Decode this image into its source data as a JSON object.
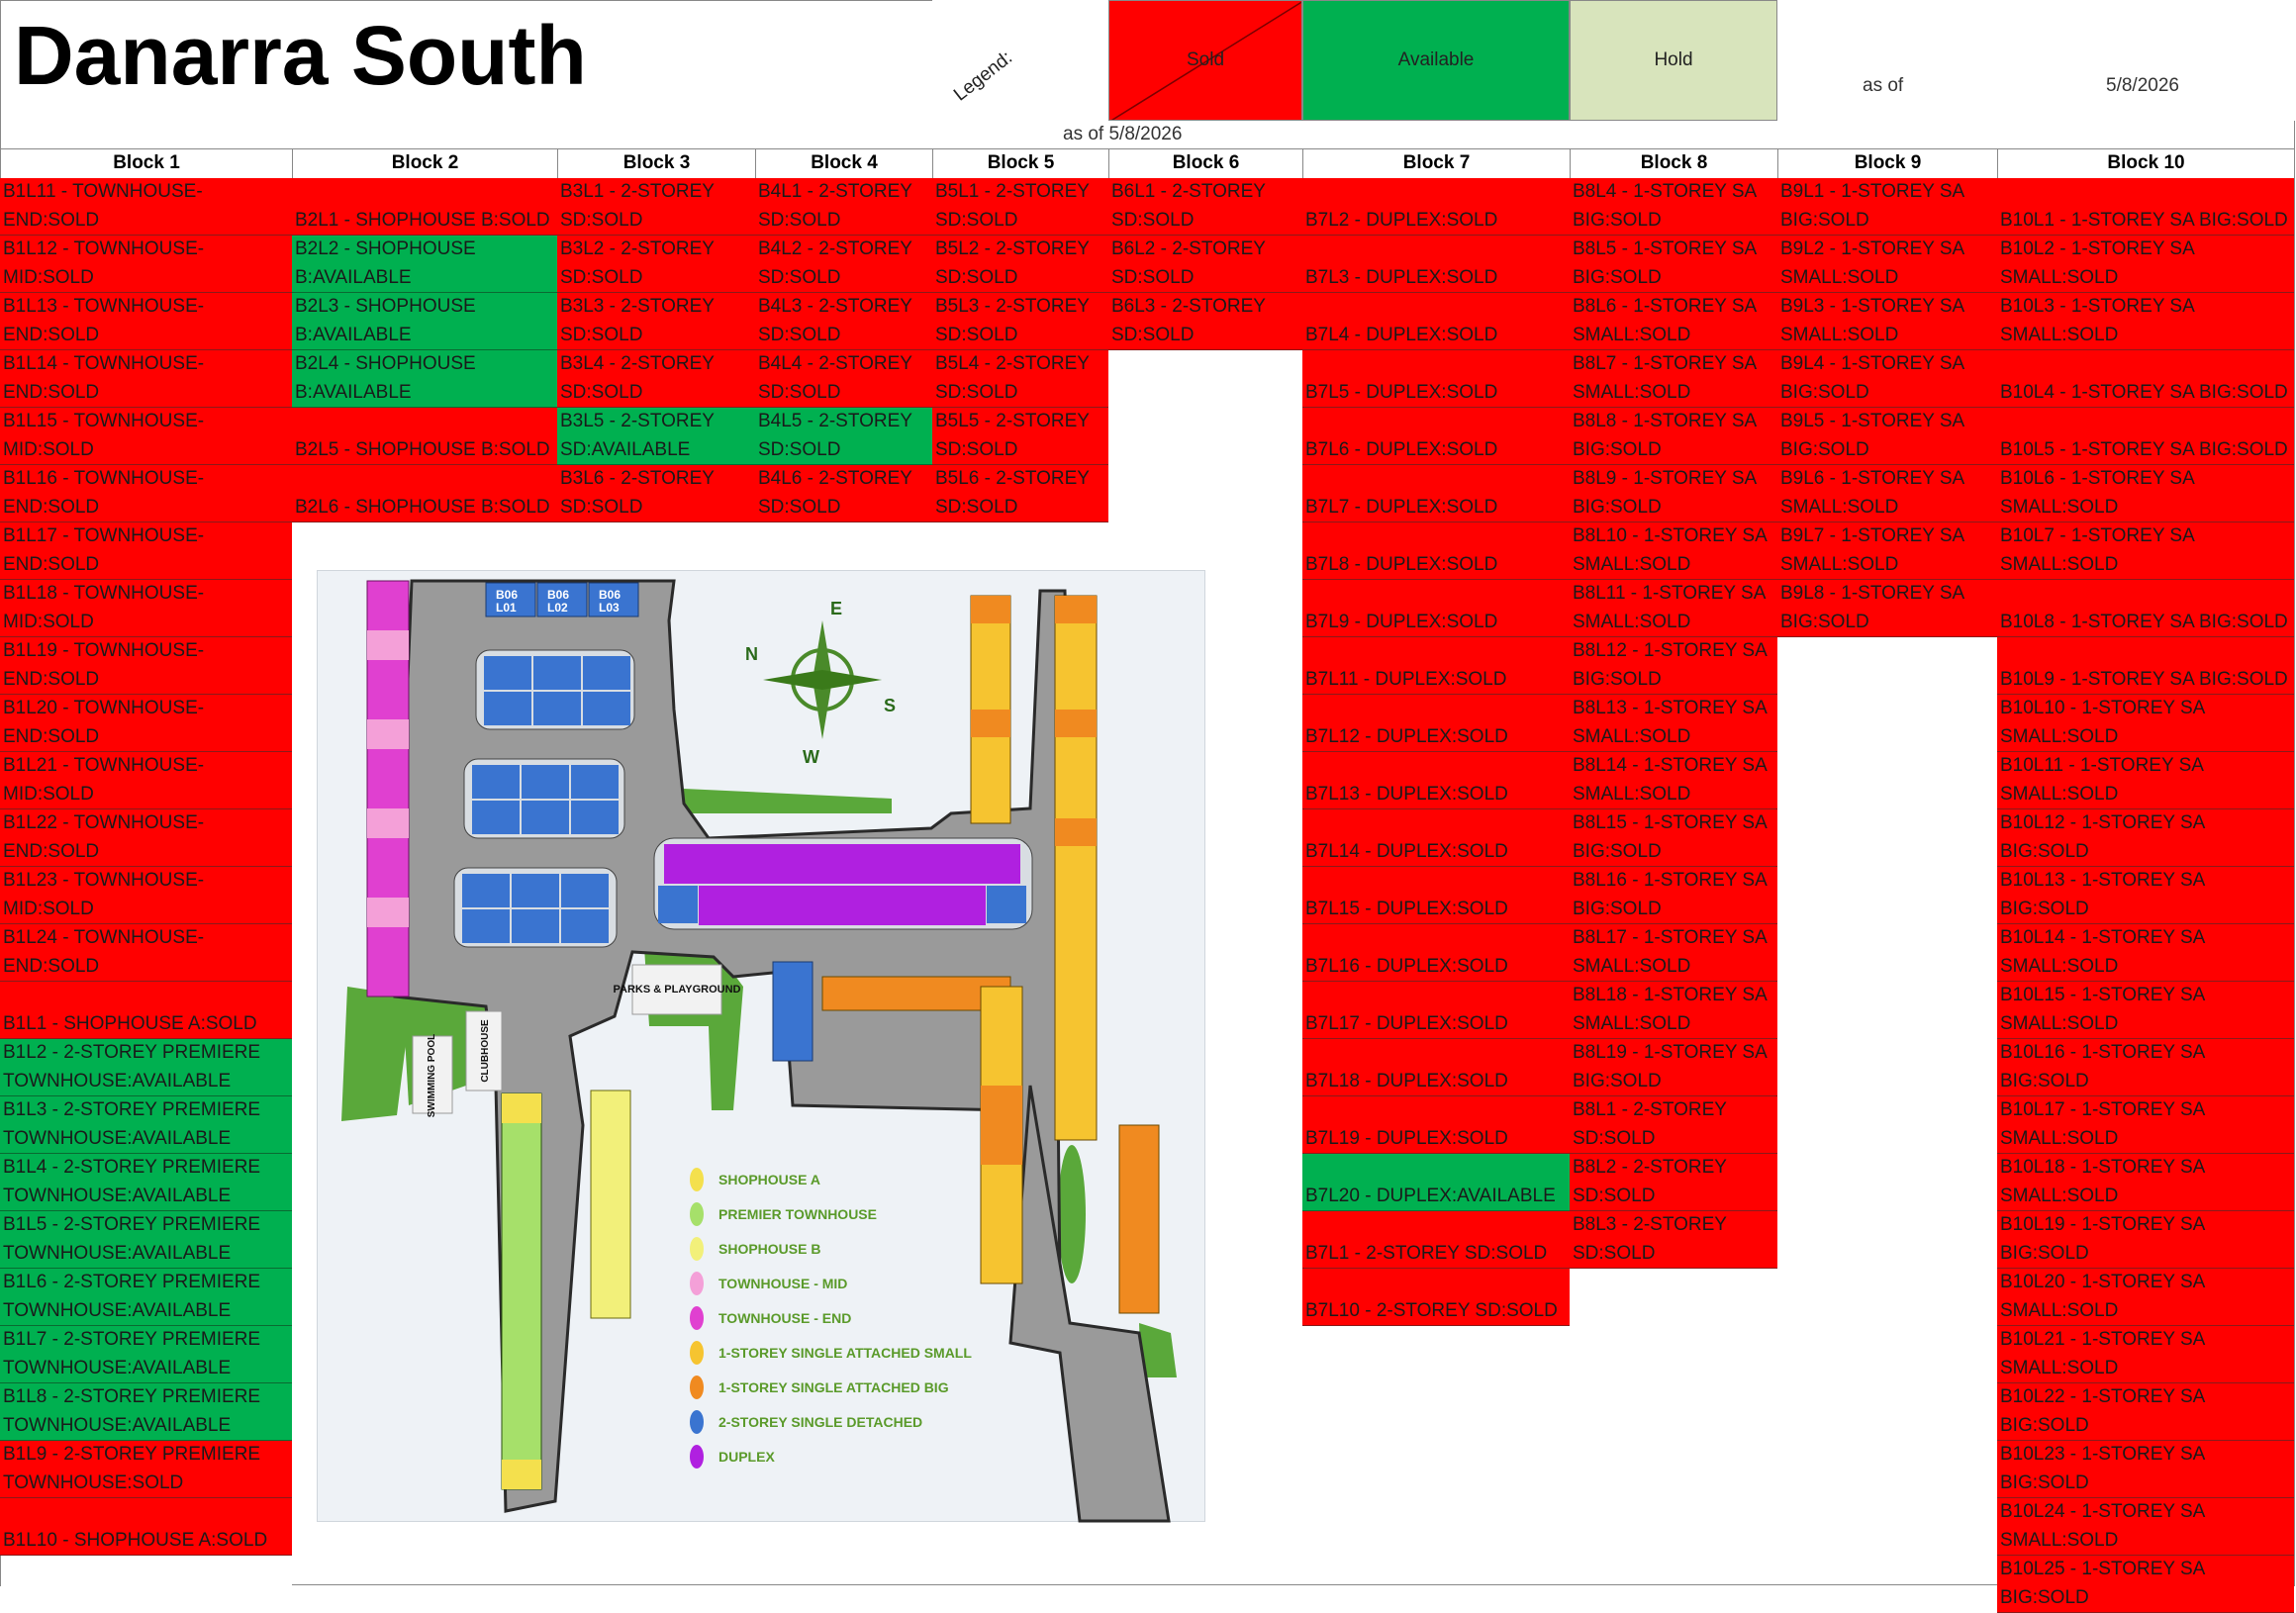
{
  "title": "Danarra South",
  "legend": {
    "label": "Legend:",
    "sold": "Sold",
    "available": "Available",
    "hold": "Hold",
    "colors": {
      "sold": "#ff0000",
      "available": "#00b050",
      "hold": "#d8e4bc"
    }
  },
  "as_of_label": "as of",
  "as_of_date": "5/8/2026",
  "as_of_combined": "as of  5/8/2026",
  "columns": [
    {
      "header": "Block 1",
      "cells": [
        {
          "text": "B1L11 - TOWNHOUSE-END:SOLD",
          "status": "sold"
        },
        {
          "text": "B1L12 - TOWNHOUSE-MID:SOLD",
          "status": "sold"
        },
        {
          "text": "B1L13 - TOWNHOUSE-END:SOLD",
          "status": "sold"
        },
        {
          "text": "B1L14 - TOWNHOUSE-END:SOLD",
          "status": "sold"
        },
        {
          "text": "B1L15 - TOWNHOUSE-MID:SOLD",
          "status": "sold"
        },
        {
          "text": "B1L16 - TOWNHOUSE-END:SOLD",
          "status": "sold"
        },
        {
          "text": "B1L17 - TOWNHOUSE-END:SOLD",
          "status": "sold"
        },
        {
          "text": "B1L18 - TOWNHOUSE-MID:SOLD",
          "status": "sold"
        },
        {
          "text": "B1L19 - TOWNHOUSE-END:SOLD",
          "status": "sold"
        },
        {
          "text": "B1L20 - TOWNHOUSE-END:SOLD",
          "status": "sold"
        },
        {
          "text": "B1L21 - TOWNHOUSE-MID:SOLD",
          "status": "sold"
        },
        {
          "text": "B1L22 - TOWNHOUSE-END:SOLD",
          "status": "sold"
        },
        {
          "text": "B1L23 - TOWNHOUSE-MID:SOLD",
          "status": "sold"
        },
        {
          "text": "B1L24 - TOWNHOUSE-END:SOLD",
          "status": "sold"
        },
        {
          "text": "B1L1 - SHOPHOUSE A:SOLD",
          "status": "sold"
        },
        {
          "text": "B1L2 - 2-STOREY PREMIERE TOWNHOUSE:AVAILABLE",
          "status": "avail"
        },
        {
          "text": "B1L3 - 2-STOREY PREMIERE TOWNHOUSE:AVAILABLE",
          "status": "avail"
        },
        {
          "text": "B1L4 - 2-STOREY PREMIERE TOWNHOUSE:AVAILABLE",
          "status": "avail"
        },
        {
          "text": "B1L5 - 2-STOREY PREMIERE TOWNHOUSE:AVAILABLE",
          "status": "avail"
        },
        {
          "text": "B1L6 - 2-STOREY PREMIERE TOWNHOUSE:AVAILABLE",
          "status": "avail"
        },
        {
          "text": "B1L7 - 2-STOREY PREMIERE TOWNHOUSE:AVAILABLE",
          "status": "avail"
        },
        {
          "text": "B1L8 - 2-STOREY PREMIERE TOWNHOUSE:AVAILABLE",
          "status": "avail"
        },
        {
          "text": "B1L9 - 2-STOREY PREMIERE TOWNHOUSE:SOLD",
          "status": "sold"
        },
        {
          "text": "B1L10 - SHOPHOUSE A:SOLD",
          "status": "sold"
        }
      ]
    },
    {
      "header": "Block 2",
      "cells": [
        {
          "text": "B2L1 - SHOPHOUSE B:SOLD",
          "status": "sold"
        },
        {
          "text": "B2L2 - SHOPHOUSE B:AVAILABLE",
          "status": "avail"
        },
        {
          "text": "B2L3 - SHOPHOUSE B:AVAILABLE",
          "status": "avail"
        },
        {
          "text": "B2L4 - SHOPHOUSE B:AVAILABLE",
          "status": "avail"
        },
        {
          "text": "B2L5 - SHOPHOUSE B:SOLD",
          "status": "sold"
        },
        {
          "text": "B2L6 - SHOPHOUSE B:SOLD",
          "status": "sold"
        }
      ]
    },
    {
      "header": "Block 3",
      "cells": [
        {
          "text": "B3L1 - 2-STOREY SD:SOLD",
          "status": "sold"
        },
        {
          "text": "B3L2 - 2-STOREY SD:SOLD",
          "status": "sold"
        },
        {
          "text": "B3L3 - 2-STOREY SD:SOLD",
          "status": "sold"
        },
        {
          "text": "B3L4 - 2-STOREY SD:SOLD",
          "status": "sold"
        },
        {
          "text": "B3L5 - 2-STOREY SD:AVAILABLE",
          "status": "avail"
        },
        {
          "text": "B3L6 - 2-STOREY SD:SOLD",
          "status": "sold"
        }
      ]
    },
    {
      "header": "Block 4",
      "cells": [
        {
          "text": "B4L1 - 2-STOREY SD:SOLD",
          "status": "sold"
        },
        {
          "text": "B4L2 - 2-STOREY SD:SOLD",
          "status": "sold"
        },
        {
          "text": "B4L3 - 2-STOREY SD:SOLD",
          "status": "sold"
        },
        {
          "text": "B4L4 - 2-STOREY SD:SOLD",
          "status": "sold"
        },
        {
          "text": "B4L5 - 2-STOREY SD:SOLD",
          "status": "avail"
        },
        {
          "text": "B4L6 - 2-STOREY SD:SOLD",
          "status": "sold"
        }
      ]
    },
    {
      "header": "Block 5",
      "cells": [
        {
          "text": "B5L1 - 2-STOREY SD:SOLD",
          "status": "sold"
        },
        {
          "text": "B5L2 - 2-STOREY SD:SOLD",
          "status": "sold"
        },
        {
          "text": "B5L3 - 2-STOREY SD:SOLD",
          "status": "sold"
        },
        {
          "text": "B5L4 - 2-STOREY SD:SOLD",
          "status": "sold"
        },
        {
          "text": "B5L5 - 2-STOREY SD:SOLD",
          "status": "sold"
        },
        {
          "text": "B5L6 - 2-STOREY SD:SOLD",
          "status": "sold"
        }
      ]
    },
    {
      "header": "Block 6",
      "cells": [
        {
          "text": "B6L1 - 2-STOREY SD:SOLD",
          "status": "sold"
        },
        {
          "text": "B6L2 - 2-STOREY SD:SOLD",
          "status": "sold"
        },
        {
          "text": "B6L3 - 2-STOREY SD:SOLD",
          "status": "sold"
        }
      ]
    },
    {
      "header": "Block 7",
      "cells": [
        {
          "text": "B7L2 - DUPLEX:SOLD",
          "status": "sold"
        },
        {
          "text": "B7L3 - DUPLEX:SOLD",
          "status": "sold"
        },
        {
          "text": "B7L4 - DUPLEX:SOLD",
          "status": "sold"
        },
        {
          "text": "B7L5 - DUPLEX:SOLD",
          "status": "sold"
        },
        {
          "text": "B7L6 - DUPLEX:SOLD",
          "status": "sold"
        },
        {
          "text": "B7L7 - DUPLEX:SOLD",
          "status": "sold"
        },
        {
          "text": "B7L8 - DUPLEX:SOLD",
          "status": "sold"
        },
        {
          "text": "B7L9 - DUPLEX:SOLD",
          "status": "sold"
        },
        {
          "text": "B7L11 - DUPLEX:SOLD",
          "status": "sold"
        },
        {
          "text": "B7L12 - DUPLEX:SOLD",
          "status": "sold"
        },
        {
          "text": "B7L13 - DUPLEX:SOLD",
          "status": "sold"
        },
        {
          "text": "B7L14 - DUPLEX:SOLD",
          "status": "sold"
        },
        {
          "text": "B7L15 - DUPLEX:SOLD",
          "status": "sold"
        },
        {
          "text": "B7L16 - DUPLEX:SOLD",
          "status": "sold"
        },
        {
          "text": "B7L17 - DUPLEX:SOLD",
          "status": "sold"
        },
        {
          "text": "B7L18 - DUPLEX:SOLD",
          "status": "sold"
        },
        {
          "text": "B7L19 - DUPLEX:SOLD",
          "status": "sold"
        },
        {
          "text": "B7L20 - DUPLEX:AVAILABLE",
          "status": "avail"
        },
        {
          "text": "B7L1 - 2-STOREY SD:SOLD",
          "status": "sold"
        },
        {
          "text": "B7L10 - 2-STOREY SD:SOLD",
          "status": "sold"
        }
      ]
    },
    {
      "header": "Block 8",
      "cells": [
        {
          "text": "B8L4 - 1-STOREY SA BIG:SOLD",
          "status": "sold"
        },
        {
          "text": "B8L5 - 1-STOREY SA BIG:SOLD",
          "status": "sold"
        },
        {
          "text": "B8L6 - 1-STOREY SA SMALL:SOLD",
          "status": "sold"
        },
        {
          "text": "B8L7 - 1-STOREY SA SMALL:SOLD",
          "status": "sold"
        },
        {
          "text": "B8L8 - 1-STOREY SA BIG:SOLD",
          "status": "sold"
        },
        {
          "text": "B8L9 - 1-STOREY SA BIG:SOLD",
          "status": "sold"
        },
        {
          "text": "B8L10 - 1-STOREY SA SMALL:SOLD",
          "status": "sold"
        },
        {
          "text": "B8L11 - 1-STOREY SA SMALL:SOLD",
          "status": "sold"
        },
        {
          "text": "B8L12 - 1-STOREY SA BIG:SOLD",
          "status": "sold"
        },
        {
          "text": "B8L13 - 1-STOREY SA SMALL:SOLD",
          "status": "sold"
        },
        {
          "text": "B8L14 - 1-STOREY SA SMALL:SOLD",
          "status": "sold"
        },
        {
          "text": "B8L15 - 1-STOREY SA BIG:SOLD",
          "status": "sold"
        },
        {
          "text": "B8L16 - 1-STOREY SA BIG:SOLD",
          "status": "sold"
        },
        {
          "text": "B8L17 - 1-STOREY SA SMALL:SOLD",
          "status": "sold"
        },
        {
          "text": "B8L18 - 1-STOREY SA SMALL:SOLD",
          "status": "sold"
        },
        {
          "text": "B8L19 - 1-STOREY SA BIG:SOLD",
          "status": "sold"
        },
        {
          "text": "B8L1 - 2-STOREY SD:SOLD",
          "status": "sold"
        },
        {
          "text": "B8L2 - 2-STOREY SD:SOLD",
          "status": "sold"
        },
        {
          "text": "B8L3 - 2-STOREY SD:SOLD",
          "status": "sold"
        }
      ]
    },
    {
      "header": "Block 9",
      "cells": [
        {
          "text": "B9L1 - 1-STOREY SA BIG:SOLD",
          "status": "sold"
        },
        {
          "text": "B9L2 - 1-STOREY SA SMALL:SOLD",
          "status": "sold"
        },
        {
          "text": "B9L3 - 1-STOREY SA SMALL:SOLD",
          "status": "sold"
        },
        {
          "text": "B9L4 - 1-STOREY SA BIG:SOLD",
          "status": "sold"
        },
        {
          "text": "B9L5 - 1-STOREY SA BIG:SOLD",
          "status": "sold"
        },
        {
          "text": "B9L6 - 1-STOREY SA SMALL:SOLD",
          "status": "sold"
        },
        {
          "text": "B9L7 - 1-STOREY SA SMALL:SOLD",
          "status": "sold"
        },
        {
          "text": "B9L8 - 1-STOREY SA BIG:SOLD",
          "status": "sold"
        }
      ]
    },
    {
      "header": "Block 10",
      "cells": [
        {
          "text": "B10L1 - 1-STOREY SA BIG:SOLD",
          "status": "sold"
        },
        {
          "text": "B10L2 - 1-STOREY SA SMALL:SOLD",
          "status": "sold"
        },
        {
          "text": "B10L3 - 1-STOREY SA SMALL:SOLD",
          "status": "sold"
        },
        {
          "text": "B10L4 - 1-STOREY SA BIG:SOLD",
          "status": "sold"
        },
        {
          "text": "B10L5 - 1-STOREY SA BIG:SOLD",
          "status": "sold"
        },
        {
          "text": "B10L6 - 1-STOREY SA SMALL:SOLD",
          "status": "sold"
        },
        {
          "text": "B10L7 - 1-STOREY SA SMALL:SOLD",
          "status": "sold"
        },
        {
          "text": "B10L8 - 1-STOREY SA BIG:SOLD",
          "status": "sold"
        },
        {
          "text": "B10L9 - 1-STOREY SA BIG:SOLD",
          "status": "sold"
        },
        {
          "text": "B10L10 - 1-STOREY SA SMALL:SOLD",
          "status": "sold"
        },
        {
          "text": "B10L11 - 1-STOREY SA SMALL:SOLD",
          "status": "sold"
        },
        {
          "text": "B10L12 - 1-STOREY SA BIG:SOLD",
          "status": "sold"
        },
        {
          "text": "B10L13 - 1-STOREY SA BIG:SOLD",
          "status": "sold"
        },
        {
          "text": "B10L14 - 1-STOREY SA SMALL:SOLD",
          "status": "sold"
        },
        {
          "text": "B10L15 - 1-STOREY SA SMALL:SOLD",
          "status": "sold"
        },
        {
          "text": "B10L16 - 1-STOREY SA BIG:SOLD",
          "status": "sold"
        },
        {
          "text": "B10L17 - 1-STOREY SA SMALL:SOLD",
          "status": "sold"
        },
        {
          "text": "B10L18 - 1-STOREY SA SMALL:SOLD",
          "status": "sold"
        },
        {
          "text": "B10L19 - 1-STOREY SA BIG:SOLD",
          "status": "sold"
        },
        {
          "text": "B10L20 - 1-STOREY SA SMALL:SOLD",
          "status": "sold"
        },
        {
          "text": "B10L21 - 1-STOREY SA SMALL:SOLD",
          "status": "sold"
        },
        {
          "text": "B10L22 - 1-STOREY SA BIG:SOLD",
          "status": "sold"
        },
        {
          "text": "B10L23 - 1-STOREY SA BIG:SOLD",
          "status": "sold"
        },
        {
          "text": "B10L24 - 1-STOREY SA SMALL:SOLD",
          "status": "sold"
        },
        {
          "text": "B10L25 - 1-STOREY SA BIG:SOLD",
          "status": "sold"
        }
      ]
    }
  ],
  "site_map": {
    "compass": {
      "n": "N",
      "e": "E",
      "s": "S",
      "w": "W"
    },
    "amenities": {
      "parks": "PARKS & PLAYGROUND",
      "clubhouse": "CLUBHOUSE",
      "pool": "SWIMMING POOL"
    },
    "lot_colors": {
      "shophouse_a": "#f4e04d",
      "premier_townhouse": "#a6e06a",
      "shophouse_b": "#f2f07a",
      "townhouse_mid": "#f4a0d8",
      "townhouse_end": "#e040d0",
      "sa_small": "#f6c430",
      "sa_big": "#f08a20",
      "sd": "#3a74d0",
      "duplex": "#b020e0"
    },
    "map_legend": [
      {
        "label": "SHOPHOUSE A",
        "color": "#f4e04d"
      },
      {
        "label": "PREMIER TOWNHOUSE",
        "color": "#a6e06a"
      },
      {
        "label": "SHOPHOUSE B",
        "color": "#f2f07a"
      },
      {
        "label": "TOWNHOUSE - MID",
        "color": "#f4a0d8"
      },
      {
        "label": "TOWNHOUSE - END",
        "color": "#e040d0"
      },
      {
        "label": "1-STOREY SINGLE ATTACHED SMALL",
        "color": "#f6c430"
      },
      {
        "label": "1-STOREY SINGLE ATTACHED BIG",
        "color": "#f08a20"
      },
      {
        "label": "2-STOREY SINGLE DETACHED",
        "color": "#3a74d0"
      },
      {
        "label": "DUPLEX",
        "color": "#b020e0"
      }
    ]
  }
}
